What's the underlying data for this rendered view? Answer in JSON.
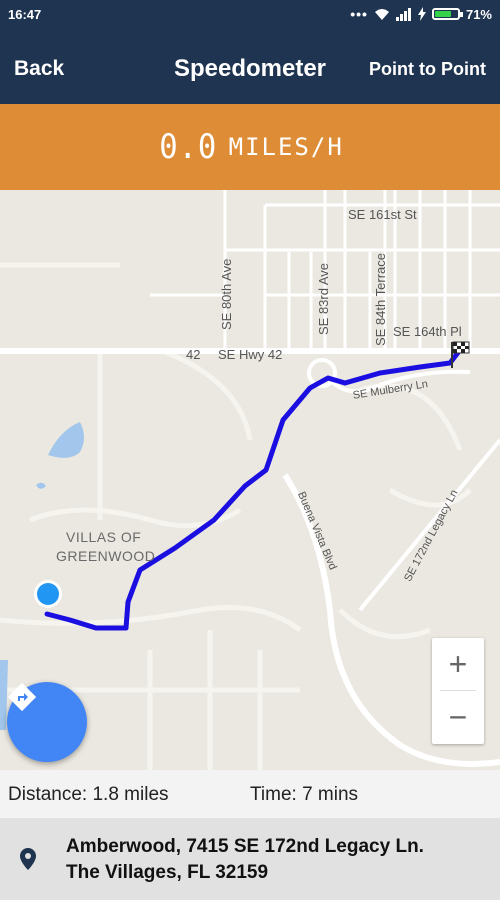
{
  "status_bar": {
    "time": "16:47",
    "battery": "71%",
    "battery_level": 0.71,
    "icons": [
      "more-dots-icon",
      "wifi-icon",
      "signal-icon",
      "charging-icon",
      "battery-icon"
    ]
  },
  "app_bar": {
    "back_label": "Back",
    "title": "Speedometer",
    "point_to_point_label": "Point to Point"
  },
  "speed": {
    "value": "0.0",
    "unit": "MILES/H",
    "background_color": "#de8d36"
  },
  "map": {
    "street_labels": {
      "se_161st": "SE 161st St",
      "se_80th": "SE 80th Ave",
      "se_83rd": "SE 83rd Ave",
      "se_84th": "SE 84th Terrace",
      "se_164th": "SE 164th Pl",
      "hwy42_number": "42",
      "hwy42": "SE Hwy 42",
      "mulberry": "SE Mulberry Ln",
      "legacy": "SE 172nd Legacy Ln",
      "legacy2": "SE 172nd Legacy Ln",
      "buena_vista": "Buena Vista Blvd"
    },
    "area_label_line1": "VILLAS OF",
    "area_label_line2": "GREENWOOD",
    "route_color": "#1a0fe0",
    "location_color": "#2196f3",
    "zoom_in_label": "+",
    "zoom_out_label": "−"
  },
  "trip": {
    "distance": "Distance: 1.8 miles",
    "time": "Time: 7 mins"
  },
  "destination": {
    "line1": "Amberwood, 7415 SE 172nd Legacy Ln.",
    "line2": "The Villages, FL 32159"
  }
}
